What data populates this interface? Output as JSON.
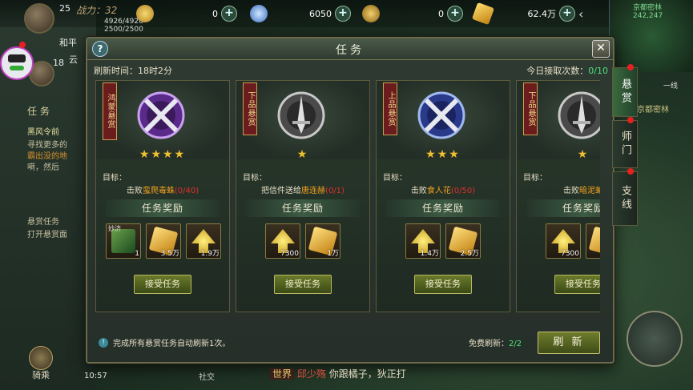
{
  "hud": {
    "power_label": "战力：32",
    "hp_text": "4926/4926",
    "mp_text": "2500/2500",
    "level_top": "25",
    "level_second": "18",
    "name_top": "和平",
    "name_second": "云",
    "resources": [
      {
        "icon": "gold-ingot-icon",
        "value": "0",
        "color": "#f0c040"
      },
      {
        "icon": "jade-coin-icon",
        "value": "6050",
        "color": "#6aa8e8"
      },
      {
        "icon": "copper-coin-icon",
        "value": "0",
        "color": "#d8b040"
      },
      {
        "icon": "bound-gold-icon",
        "value": "62.4万",
        "color": "#e8c030"
      }
    ],
    "minimap_text": "京都密林 242,247"
  },
  "modal": {
    "title": "任务",
    "refresh_time": "刷新时间：18时2分",
    "accept_today_label": "今日接取次数：",
    "accept_today_count": "0/10",
    "reward_heading": "任务奖励",
    "accept_label": "接受任务",
    "goal_label": "目标：",
    "footer_info": "完成所有悬赏任务自动刷新1次。",
    "free_refresh_label": "免费刷新：",
    "free_refresh_count": "2/2",
    "refresh_button": "刷 新"
  },
  "cards": [
    {
      "grade": "鸿蒙悬赏",
      "stars": "★★★★",
      "emblem": "purple-crossed-swords-emblem",
      "emblem_color": "#8a4ad0",
      "goal_verb": "击败",
      "goal_target": "蛮爬毒蛛",
      "goal_progress": "(0/40)",
      "rewards": [
        {
          "icon": "green-skill-book-icon",
          "label": "妙济",
          "qty": "1"
        },
        {
          "icon": "gold-coupon-icon",
          "qty": "3.5万"
        },
        {
          "icon": "exp-arrow-icon",
          "qty": "1.9万"
        }
      ]
    },
    {
      "grade": "下品悬赏",
      "stars": "★",
      "emblem": "silver-sword-emblem",
      "emblem_color": "#9a9a9a",
      "goal_verb": "把信件送给",
      "goal_target": "唐连赫",
      "goal_progress": "(0/1)",
      "rewards": [
        {
          "icon": "exp-arrow-icon",
          "qty": "7300"
        },
        {
          "icon": "gold-coupon-icon",
          "qty": "1万"
        }
      ]
    },
    {
      "grade": "上品悬赏",
      "stars": "★★★",
      "emblem": "blue-crossed-swords-emblem",
      "emblem_color": "#4a6ad8",
      "goal_verb": "击败",
      "goal_target": "食人花",
      "goal_progress": "(0/50)",
      "rewards": [
        {
          "icon": "exp-arrow-icon",
          "qty": "1.4万"
        },
        {
          "icon": "gold-coupon-icon",
          "qty": "2.5万"
        }
      ]
    },
    {
      "grade": "下品悬赏",
      "stars": "★",
      "emblem": "silver-sword-emblem",
      "emblem_color": "#9a9a9a",
      "goal_verb": "击败",
      "goal_target": "暗泥蝙",
      "goal_progress": "",
      "rewards": [
        {
          "icon": "exp-arrow-icon",
          "qty": "7300"
        },
        {
          "icon": "gold-coupon-icon",
          "qty": ""
        }
      ]
    }
  ],
  "side_tabs": [
    {
      "label": "悬赏",
      "active": true
    },
    {
      "label": "师门",
      "active": false
    },
    {
      "label": "支线",
      "active": false
    }
  ],
  "left_panel": {
    "task_tab": "任 务",
    "line1": "黑风令前",
    "line2": "寻找更多的",
    "line3": "霸出没的地",
    "line4": "嗬，然后",
    "bounty_item": "悬赏任务",
    "bounty_hint": "打开悬赏面"
  },
  "bottom": {
    "clock": "10:57",
    "mount": "骑乘",
    "social": "社交",
    "chat_channel": "世界",
    "chat_name": "邱少殇",
    "chat_text": "你跟橘子，狄正打"
  },
  "map": {
    "yixian": "一线",
    "label": "京都密林"
  }
}
